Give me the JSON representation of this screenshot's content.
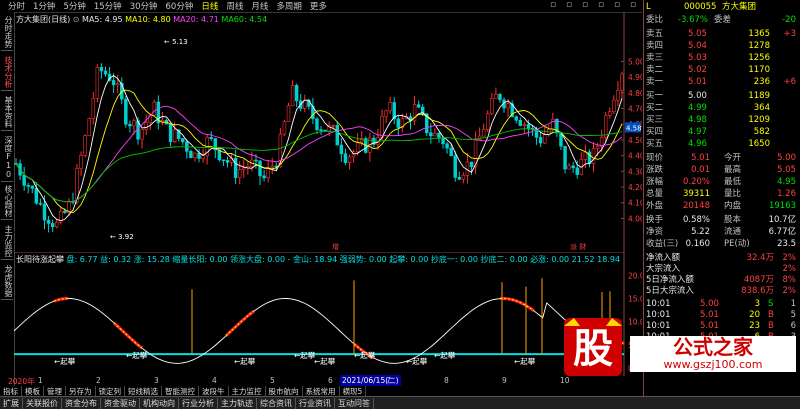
{
  "toolbar": {
    "items": [
      "分时",
      "1分钟",
      "5分钟",
      "15分钟",
      "30分钟",
      "60分钟",
      "日线",
      "周线",
      "月线",
      "多周期",
      "更多"
    ],
    "active_index": 6
  },
  "left_tabs": [
    {
      "label": "分时走势",
      "red": false
    },
    {
      "label": "技术分析",
      "red": true
    },
    {
      "label": "基本资料",
      "red": false
    },
    {
      "label": "深度F10",
      "red": false
    },
    {
      "label": "核心题材",
      "red": false
    },
    {
      "label": "主力监控",
      "red": false
    },
    {
      "label": "龙虎数据",
      "red": false
    }
  ],
  "main_chart": {
    "stock_title": "方大集团(日线)",
    "ma5": "MA5: 4.95",
    "ma10": "MA10: 4.80",
    "ma20": "MA20: 4.71",
    "ma60": "MA60: 4.54",
    "high_label": "5.13",
    "low_label": "3.92",
    "price_ticks": [
      "5.00",
      "4.90",
      "4.80",
      "4.70",
      "4.60",
      "4.50",
      "4.40",
      "4.30",
      "4.20",
      "4.10",
      "4.00"
    ],
    "current_price_tag": "4.58",
    "marker_1": "增",
    "marker_2": "派 财"
  },
  "sub_chart": {
    "title": "长阳待涨起攀",
    "params": "盘: 6.77  益: 0.32  涨: 15.28  缩量长阳: 0.00  领涨大盘: 0.00  - 金山: 18.94  强弱势: 0.00  起攀: 0.00  抄底一: 0.00  抄底二: 0.00  必涨: 0.00  21.52  18.94",
    "ticks": [
      "20.00",
      "15.00",
      "10.00",
      "5.00",
      "0.00"
    ],
    "labels": [
      "起攀",
      "起攀",
      "起攀",
      "起攀",
      "起攀",
      "起攀",
      "起攀",
      "起攀",
      "起攀",
      "起攀"
    ]
  },
  "date_bar": {
    "left": "2020年",
    "mid": "2021/06/15(二)",
    "ticks": [
      "1",
      "2",
      "3",
      "4",
      "5",
      "6",
      "7",
      "8",
      "9",
      "10"
    ]
  },
  "bottom_tabs_1": [
    "指标",
    "模板",
    "管理",
    "另存为",
    "锁定列",
    "短线精选",
    "智能测控",
    "波段牛",
    "主力监控",
    "股市航向",
    "系统常用",
    "横现5"
  ],
  "bottom_tabs_2": [
    "扩展",
    "关联报价",
    "资金分布",
    "资金驱动",
    "机构动向",
    "行业分析",
    "主力轨迹",
    "综合资讯",
    "行业资讯",
    "互动问答"
  ],
  "right_panel": {
    "code": "000055",
    "name": "方大集团",
    "l_label": "L",
    "webi_label": "委比",
    "webi_value": "-3.67%",
    "weicha_label": "委差",
    "weicha_value": "-20",
    "sell": [
      {
        "label": "卖五",
        "price": "5.05",
        "vol": "1365",
        "chg": "+3"
      },
      {
        "label": "卖四",
        "price": "5.04",
        "vol": "1278",
        "chg": ""
      },
      {
        "label": "卖三",
        "price": "5.03",
        "vol": "1256",
        "chg": ""
      },
      {
        "label": "卖二",
        "price": "5.02",
        "vol": "1170",
        "chg": ""
      },
      {
        "label": "卖一",
        "price": "5.01",
        "vol": "236",
        "chg": "+6"
      }
    ],
    "buy": [
      {
        "label": "买一",
        "price": "5.00",
        "vol": "1189",
        "chg": ""
      },
      {
        "label": "买二",
        "price": "4.99",
        "vol": "364",
        "chg": ""
      },
      {
        "label": "买三",
        "price": "4.98",
        "vol": "1209",
        "chg": ""
      },
      {
        "label": "买四",
        "price": "4.97",
        "vol": "582",
        "chg": ""
      },
      {
        "label": "买五",
        "price": "4.96",
        "vol": "1650",
        "chg": ""
      }
    ],
    "stats": [
      {
        "l1": "现价",
        "v1": "5.01",
        "l2": "今开",
        "v2": "5.00"
      },
      {
        "l1": "涨跌",
        "v1": "0.01",
        "l2": "最高",
        "v2": "5.05"
      },
      {
        "l1": "涨幅",
        "v1": "0.20%",
        "l2": "最低",
        "v2": "4.95"
      },
      {
        "l1": "总量",
        "v1": "39311",
        "l2": "量比",
        "v2": "1.26"
      },
      {
        "l1": "外盘",
        "v1": "20148",
        "l2": "内盘",
        "v2": "19163"
      }
    ],
    "stats2": [
      {
        "l1": "换手",
        "v1": "0.58%",
        "l2": "股本",
        "v2": "10.7亿"
      },
      {
        "l1": "净资",
        "v1": "5.22",
        "l2": "流通",
        "v2": "6.77亿"
      },
      {
        "l1": "收益(三)",
        "v1": "0.160",
        "l2": "PE(动)",
        "v2": "23.5"
      }
    ],
    "flow": [
      {
        "label": "净流入额",
        "value": "32.4万",
        "pct": "2%"
      },
      {
        "label": "大宗流入",
        "value": "",
        "pct": "2%"
      },
      {
        "label": "5日净流入额",
        "value": "4087万",
        "pct": "8%"
      },
      {
        "label": "5日大宗流入",
        "value": "838.6万",
        "pct": "2%"
      }
    ],
    "ticks": [
      {
        "t": "10:01",
        "p": "5.00",
        "v": "3",
        "s": "S",
        "n": "1"
      },
      {
        "t": "10:01",
        "p": "5.01",
        "v": "20",
        "s": "B",
        "n": "5"
      },
      {
        "t": "10:01",
        "p": "5.01",
        "v": "23",
        "s": "B",
        "n": "6"
      },
      {
        "t": "10:01",
        "p": "5.01",
        "v": "6",
        "s": "B",
        "n": "3"
      },
      {
        "t": "10:01",
        "p": "5.00",
        "v": "40",
        "s": "S",
        "n": "2"
      },
      {
        "t": "10:01",
        "p": "5.01",
        "v": "4",
        "s": "B",
        "n": "2"
      }
    ]
  },
  "logo": {
    "big": "股",
    "text": "公式之家",
    "url": "www.gszj100.com"
  }
}
